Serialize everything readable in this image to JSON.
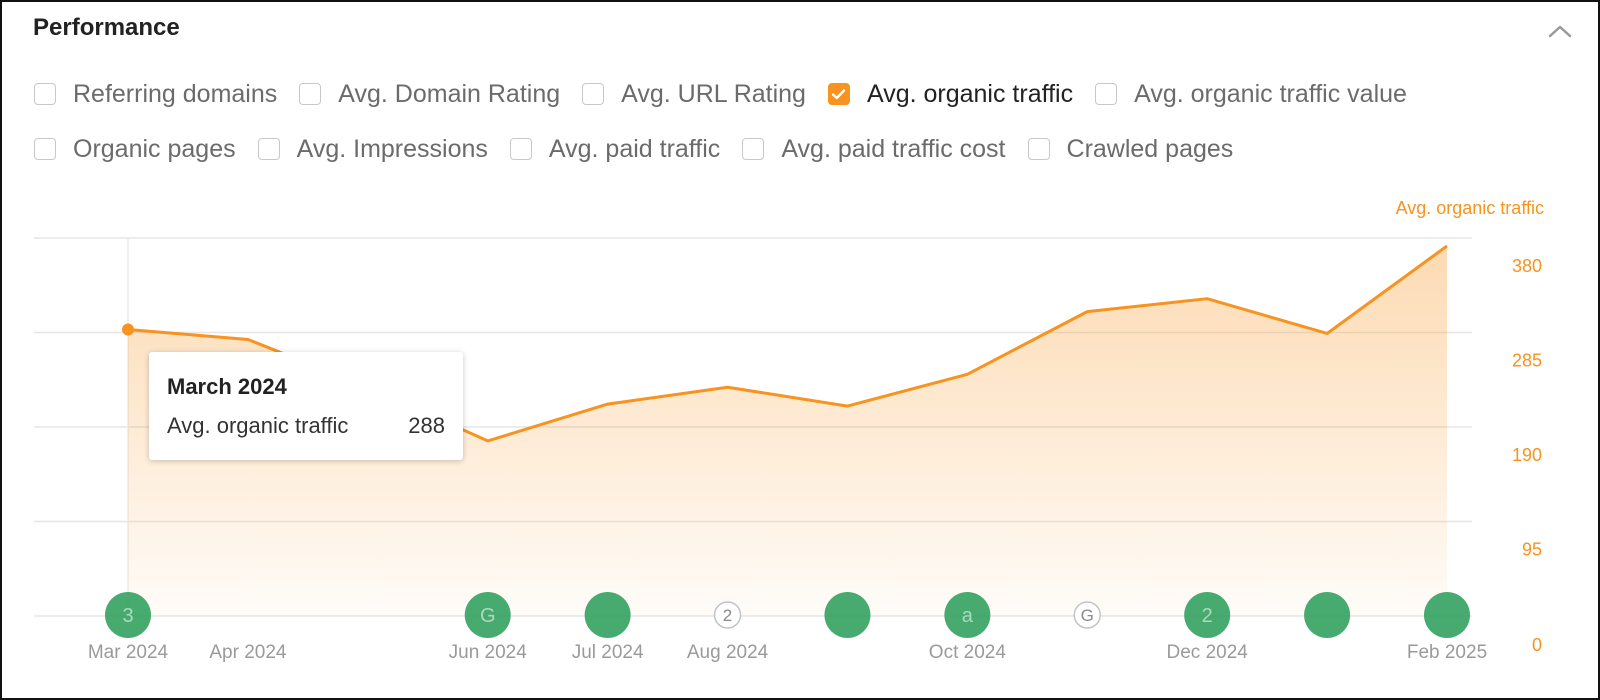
{
  "panel": {
    "title": "Performance"
  },
  "metrics": {
    "row1": [
      {
        "label": "Referring domains",
        "checked": false
      },
      {
        "label": "Avg. Domain Rating",
        "checked": false
      },
      {
        "label": "Avg. URL Rating",
        "checked": false
      },
      {
        "label": "Avg. organic traffic",
        "checked": true
      },
      {
        "label": "Avg. organic traffic value",
        "checked": false
      }
    ],
    "row2": [
      {
        "label": "Organic pages",
        "checked": false
      },
      {
        "label": "Avg. Impressions",
        "checked": false
      },
      {
        "label": "Avg. paid traffic",
        "checked": false
      },
      {
        "label": "Avg. paid traffic cost",
        "checked": false
      },
      {
        "label": "Crawled pages",
        "checked": false
      }
    ]
  },
  "colors": {
    "accent": "#f7931e",
    "axis_text": "#f7931e",
    "grid": "#e6e6e6",
    "marker_green": "#2e9e5b",
    "tick_text": "#9a9a9a"
  },
  "tooltip": {
    "title": "March 2024",
    "metric_label": "Avg. organic traffic",
    "metric_value": "288"
  },
  "chart_data": {
    "type": "area",
    "series": [
      {
        "name": "Avg. organic traffic",
        "x": [
          "2024-03",
          "2024-04",
          "2024-05",
          "2024-06",
          "2024-07",
          "2024-08",
          "2024-09",
          "2024-10",
          "2024-11",
          "2024-12",
          "2025-01",
          "2025-02"
        ],
        "values": [
          288,
          278,
          230,
          176,
          213,
          230,
          211,
          243,
          306,
          319,
          284,
          372
        ]
      }
    ],
    "x_ticks": [
      {
        "x": "2024-03",
        "label": "Mar 2024"
      },
      {
        "x": "2024-04",
        "label": "Apr 2024"
      },
      {
        "x": "2024-06",
        "label": "Jun 2024"
      },
      {
        "x": "2024-07",
        "label": "Jul 2024"
      },
      {
        "x": "2024-08",
        "label": "Aug 2024"
      },
      {
        "x": "2024-10",
        "label": "Oct 2024"
      },
      {
        "x": "2024-12",
        "label": "Dec 2024"
      },
      {
        "x": "2025-02",
        "label": "Feb 2025"
      }
    ],
    "y_axis": {
      "label": "Avg. organic traffic",
      "position": "right",
      "ticks": [
        0,
        95,
        190,
        285,
        380
      ],
      "range": [
        0,
        380
      ]
    },
    "grid": true,
    "highlight": {
      "x": "2024-03"
    },
    "event_markers": [
      {
        "x": "2024-03",
        "style": "filled",
        "label": "3"
      },
      {
        "x": "2024-06",
        "style": "filled",
        "label": "G"
      },
      {
        "x": "2024-07",
        "style": "filled",
        "label": ""
      },
      {
        "x": "2024-08",
        "style": "outline",
        "label": "2"
      },
      {
        "x": "2024-09",
        "style": "filled",
        "label": ""
      },
      {
        "x": "2024-10",
        "style": "filled",
        "label": "a"
      },
      {
        "x": "2024-11",
        "style": "outline",
        "label": "G"
      },
      {
        "x": "2024-12",
        "style": "filled",
        "label": "2"
      },
      {
        "x": "2025-01",
        "style": "filled",
        "label": ""
      },
      {
        "x": "2025-02",
        "style": "filled",
        "label": ""
      }
    ]
  }
}
